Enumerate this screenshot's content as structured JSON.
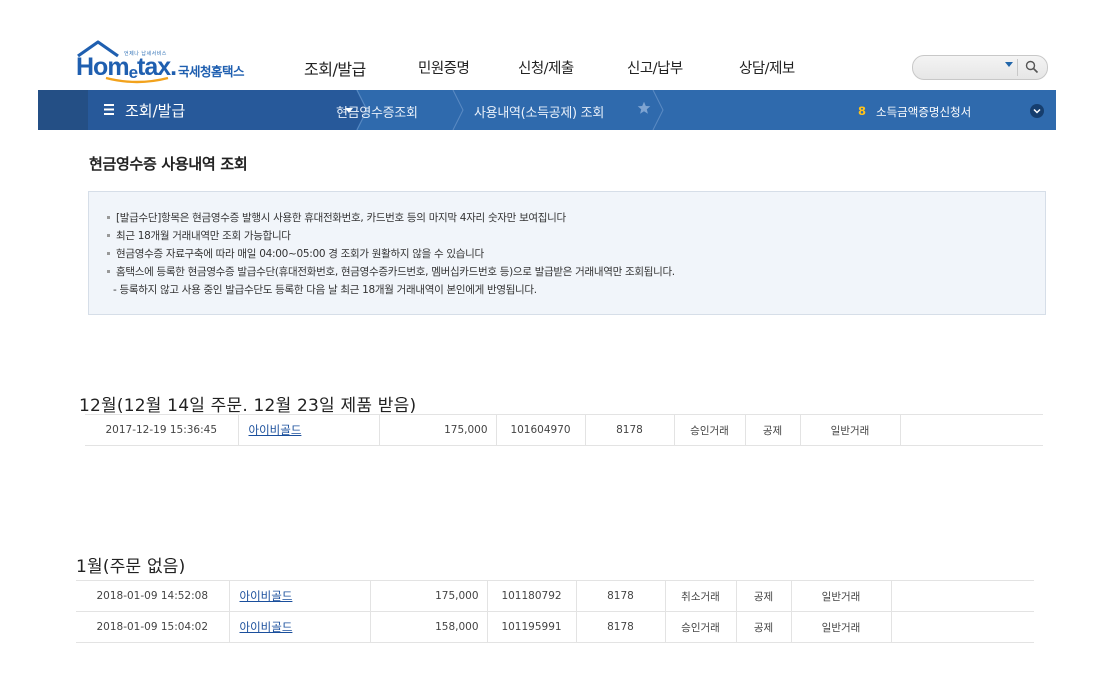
{
  "brand": {
    "tagline": "언제나 납세서비스",
    "name_prefix": "Hom",
    "name_e": "e",
    "name_suffix": "tax.",
    "name_kr": "국세청홈택스"
  },
  "gnb": {
    "items": [
      {
        "label": "조회/발급",
        "active": true
      },
      {
        "label": "민원증명"
      },
      {
        "label": "신청/제출"
      },
      {
        "label": "신고/납부"
      },
      {
        "label": "상담/제보"
      }
    ]
  },
  "search": {
    "placeholder": ""
  },
  "location": {
    "menu_label": "조회/발급",
    "crumb1": "현금영수증조회",
    "crumb2": "사용내역(소득공제) 조회",
    "badge": "8",
    "shortcut": "소득금액증명신청서"
  },
  "page": {
    "title": "현금영수증 사용내역 조회",
    "notices": [
      "[발급수단]항목은 현금영수증 발행시 사용한 휴대전화번호, 카드번호 등의 마지막 4자리 숫자만 보여집니다",
      "최근 18개월 거래내역만 조회 가능합니다",
      "현금영수증 자료구축에 따라 매일 04:00~05:00 경 조회가 원활하지 않을 수 있습니다",
      "홈택스에 등록한 현금영수증 발급수단(휴대전화번호, 현금영수증카드번호, 멤버십카드번호 등)으로 발급받은 거래내역만 조회됩니다."
    ],
    "notice_sub": "- 등록하지 않고 사용 중인 발급수단도 등록한 다음 날 최근 18개월 거래내역이 본인에게 반영됩니다."
  },
  "sections": [
    {
      "heading": "12월(12월 14일 주문. 12월 23일 제품 받음)",
      "rows": [
        {
          "datetime": "2017-12-19 15:36:45",
          "merchant": "아이비골드",
          "amount": "175,000",
          "approval": "101604970",
          "card": "8178",
          "type": "승인거래",
          "deduct": "공제",
          "category": "일반거래"
        }
      ]
    },
    {
      "heading": "1월(주문 없음)",
      "rows": [
        {
          "datetime": "2018-01-09 14:52:08",
          "merchant": "아이비골드",
          "amount": "175,000",
          "approval": "101180792",
          "card": "8178",
          "type": "취소거래",
          "deduct": "공제",
          "category": "일반거래"
        },
        {
          "datetime": "2018-01-09 15:04:02",
          "merchant": "아이비골드",
          "amount": "158,000",
          "approval": "101195991",
          "card": "8178",
          "type": "승인거래",
          "deduct": "공제",
          "category": "일반거래"
        }
      ]
    }
  ],
  "colors": {
    "accent": "#2f6aad",
    "accent_dark": "#244f85",
    "link": "#1a4f9c",
    "badge": "#ffc21a"
  }
}
